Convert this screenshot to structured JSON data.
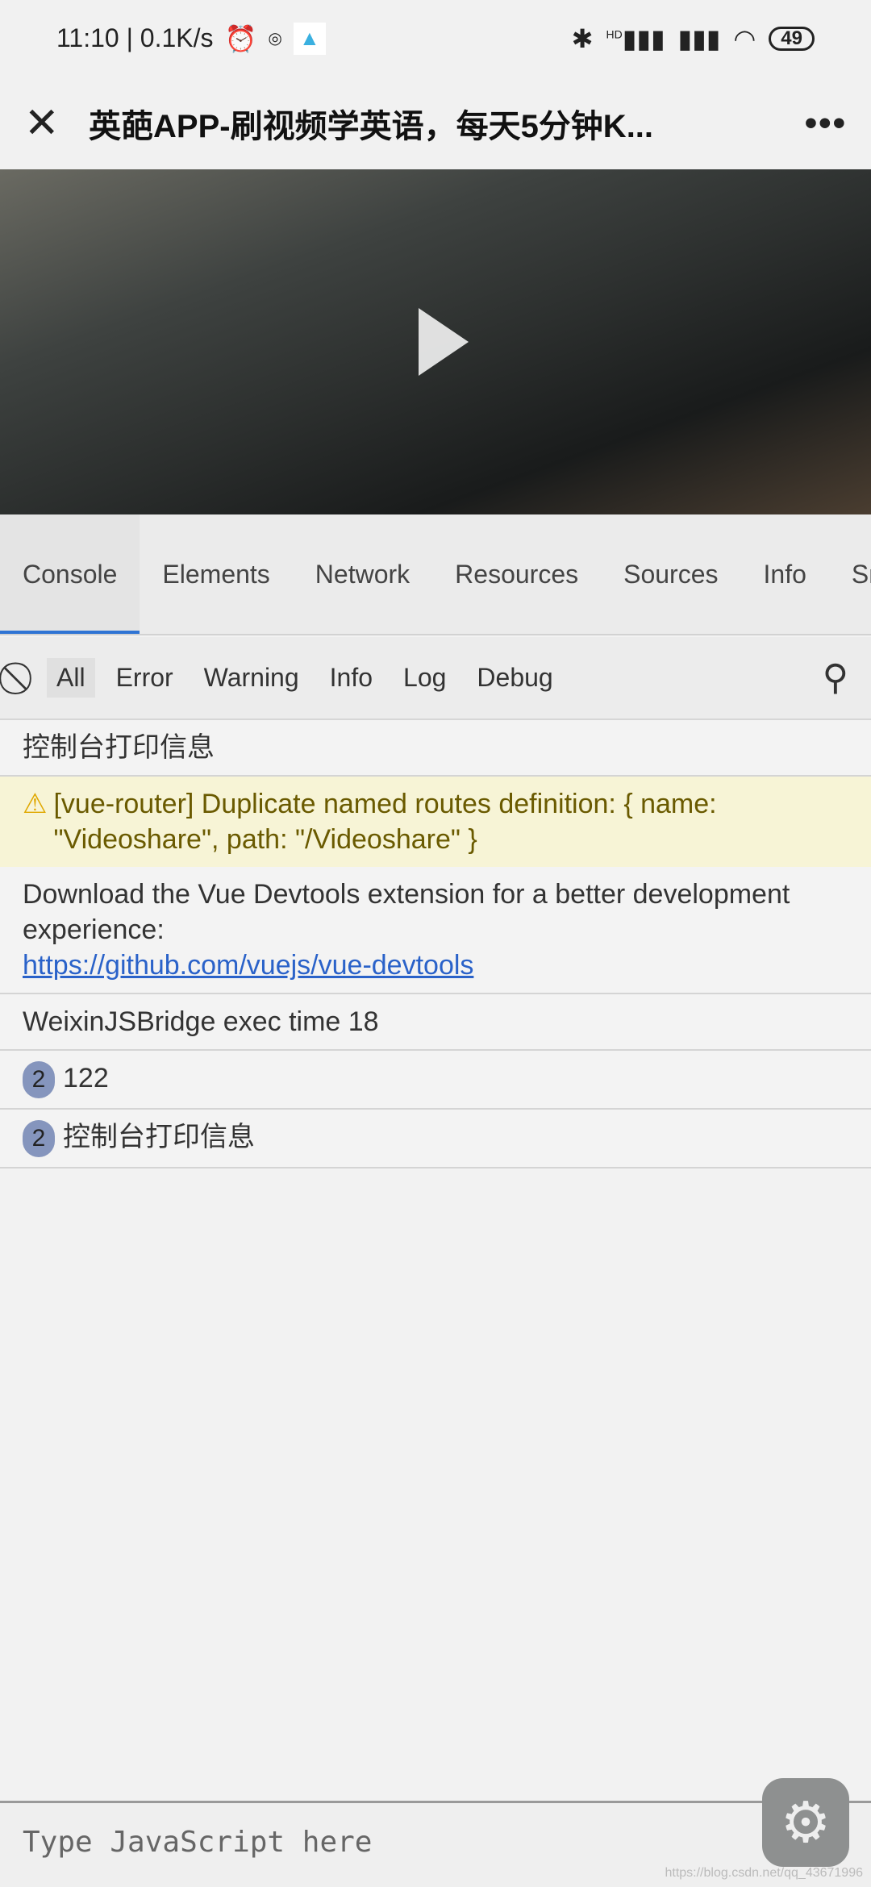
{
  "status_bar": {
    "time_speed": "11:10 | 0.1K/s",
    "network": "HD",
    "battery": "49"
  },
  "titlebar": {
    "title": "英葩APP-刷视频学英语，每天5分钟K...",
    "close_icon": "close-icon",
    "more_icon": "more-icon"
  },
  "tabs": [
    {
      "label": "Console",
      "active": true
    },
    {
      "label": "Elements"
    },
    {
      "label": "Network"
    },
    {
      "label": "Resources"
    },
    {
      "label": "Sources"
    },
    {
      "label": "Info"
    },
    {
      "label": "Sn"
    }
  ],
  "filters": [
    {
      "label": "All",
      "selected": true
    },
    {
      "label": "Error"
    },
    {
      "label": "Warning"
    },
    {
      "label": "Info"
    },
    {
      "label": "Log"
    },
    {
      "label": "Debug"
    }
  ],
  "logs": {
    "l1": "控制台打印信息",
    "warn": "[vue-router] Duplicate named routes definition: { name: \"Videoshare\", path: \"/Videoshare\" }",
    "download": "Download the Vue Devtools extension for a better development experience:",
    "link": "https://github.com/vuejs/vue-devtools",
    "weixin": "WeixinJSBridge exec time 18",
    "r5_count": "2",
    "r5": "122",
    "r6_count": "2",
    "r6": "控制台打印信息"
  },
  "input": {
    "placeholder": "Type JavaScript here"
  },
  "watermark": "https://blog.csdn.net/qq_43671996",
  "colors": {
    "accent": "#2f74d4",
    "warning_bg": "#f7f4d6",
    "link": "#2a62c9"
  }
}
